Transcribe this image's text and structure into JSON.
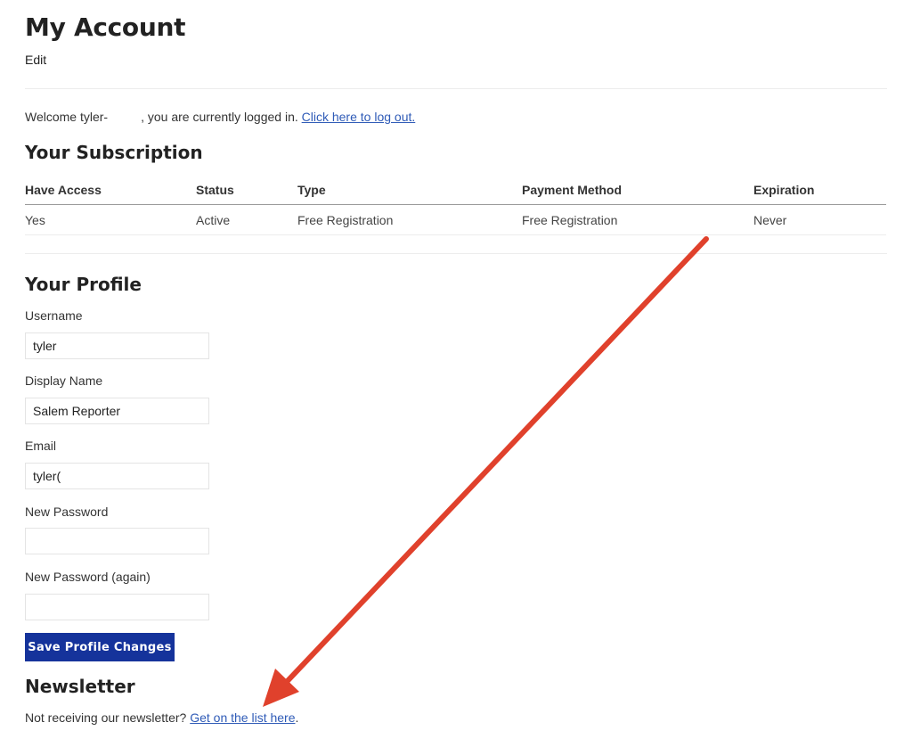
{
  "header": {
    "title": "My Account",
    "edit_label": "Edit"
  },
  "welcome": {
    "prefix": "Welcome tyler-",
    "suffix": ", you are currently logged in. ",
    "logout_link": "Click here to log out."
  },
  "subscription": {
    "title": "Your Subscription",
    "columns": [
      "Have Access",
      "Status",
      "Type",
      "Payment Method",
      "Expiration"
    ],
    "rows": [
      [
        "Yes",
        "Active",
        "Free Registration",
        "Free Registration",
        "Never"
      ]
    ]
  },
  "profile": {
    "title": "Your Profile",
    "fields": [
      {
        "label": "Username",
        "value": "tyler"
      },
      {
        "label": "Display Name",
        "value": "Salem Reporter"
      },
      {
        "label": "Email",
        "value": "tyler("
      },
      {
        "label": "New Password",
        "value": ""
      },
      {
        "label": "New Password (again)",
        "value": ""
      }
    ],
    "save_label": "Save Profile Changes"
  },
  "newsletter": {
    "title": "Newsletter",
    "text": "Not receiving our newsletter? ",
    "link": "Get on the list here",
    "end": "."
  },
  "annotation": {
    "arrow_color": "#e0412c"
  },
  "colors": {
    "button": "#15339b",
    "link": "#2f5bb7"
  }
}
